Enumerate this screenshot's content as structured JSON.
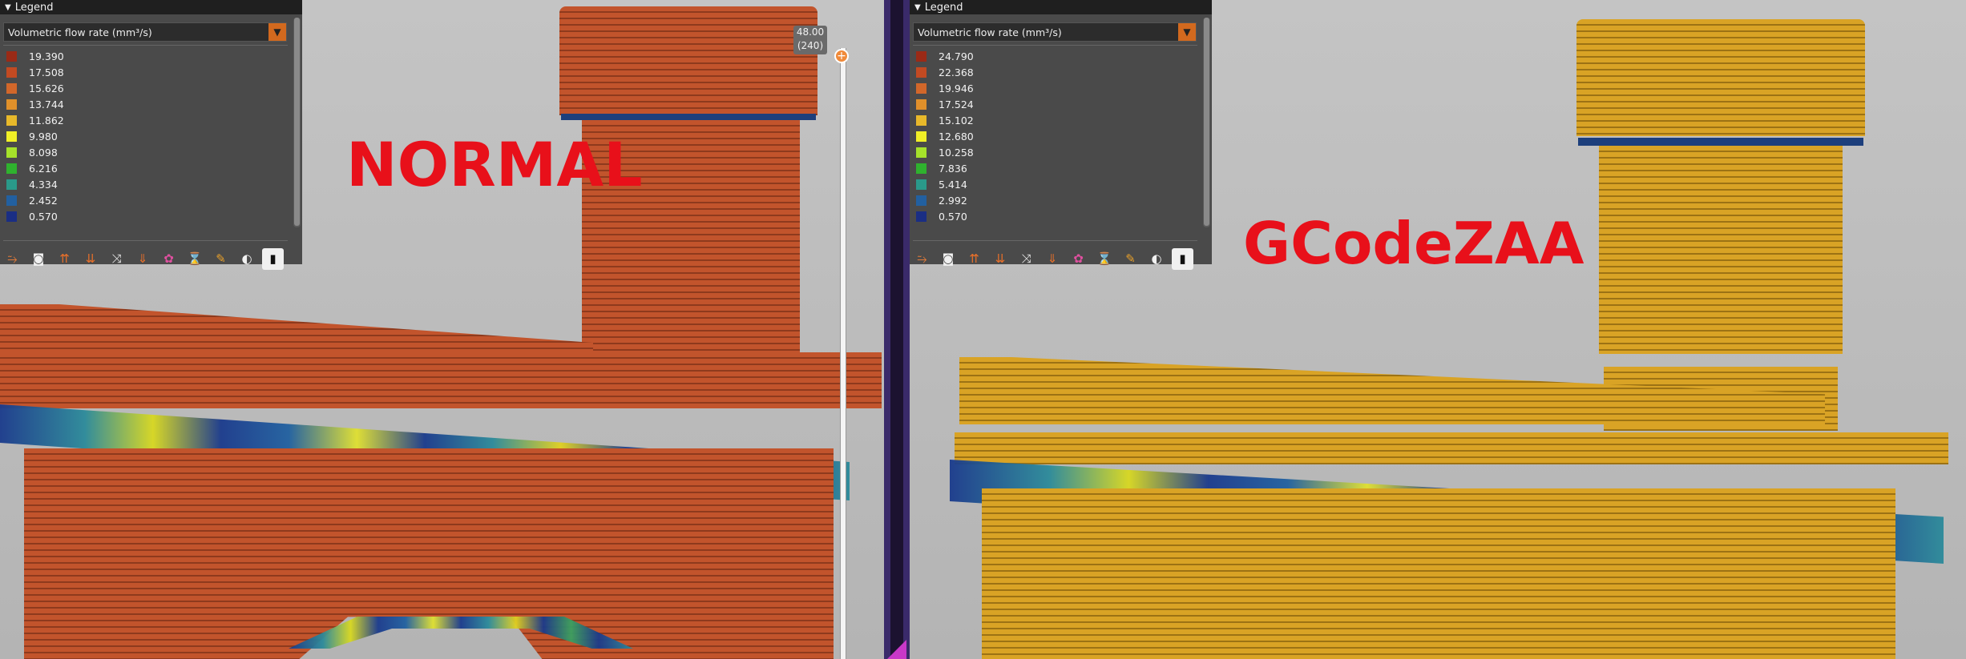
{
  "left_view": {
    "overlay_label": "NORMAL",
    "legend": {
      "title": "Legend",
      "combo_value": "Volumetric flow rate (mm³/s)",
      "items": [
        {
          "value": "19.390",
          "color": "#9a2a16"
        },
        {
          "value": "17.508",
          "color": "#c24a22"
        },
        {
          "value": "15.626",
          "color": "#d2672a"
        },
        {
          "value": "13.744",
          "color": "#e0902a"
        },
        {
          "value": "11.862",
          "color": "#e8b92a"
        },
        {
          "value": "9.980",
          "color": "#f0ef26"
        },
        {
          "value": "8.098",
          "color": "#a6e22a"
        },
        {
          "value": "6.216",
          "color": "#2fb22e"
        },
        {
          "value": "4.334",
          "color": "#2a9a8a"
        },
        {
          "value": "2.452",
          "color": "#2260a0"
        },
        {
          "value": "0.570",
          "color": "#1a2e84"
        }
      ]
    },
    "slider": {
      "height_value": "48.00",
      "layer_value": "(240)"
    }
  },
  "right_view": {
    "overlay_label": "GCodeZAA",
    "legend": {
      "title": "Legend",
      "combo_value": "Volumetric flow rate (mm³/s)",
      "items": [
        {
          "value": "24.790",
          "color": "#9a2a16"
        },
        {
          "value": "22.368",
          "color": "#c24a22"
        },
        {
          "value": "19.946",
          "color": "#d2672a"
        },
        {
          "value": "17.524",
          "color": "#e0902a"
        },
        {
          "value": "15.102",
          "color": "#e8b92a"
        },
        {
          "value": "12.680",
          "color": "#f0ef26"
        },
        {
          "value": "10.258",
          "color": "#a6e22a"
        },
        {
          "value": "7.836",
          "color": "#2fb22e"
        },
        {
          "value": "5.414",
          "color": "#2a9a8a"
        },
        {
          "value": "2.992",
          "color": "#2260a0"
        },
        {
          "value": "0.570",
          "color": "#1a2e84"
        }
      ]
    }
  },
  "toolbar_icons": [
    "travel-moves-icon",
    "wipe-icon",
    "retractions-icon",
    "deretractions-icon",
    "seams-icon",
    "tool-changes-icon",
    "color-changes-icon",
    "pause-prints-icon",
    "custom-gcode-icon",
    "center-of-gravity-icon",
    "shells-icon"
  ]
}
